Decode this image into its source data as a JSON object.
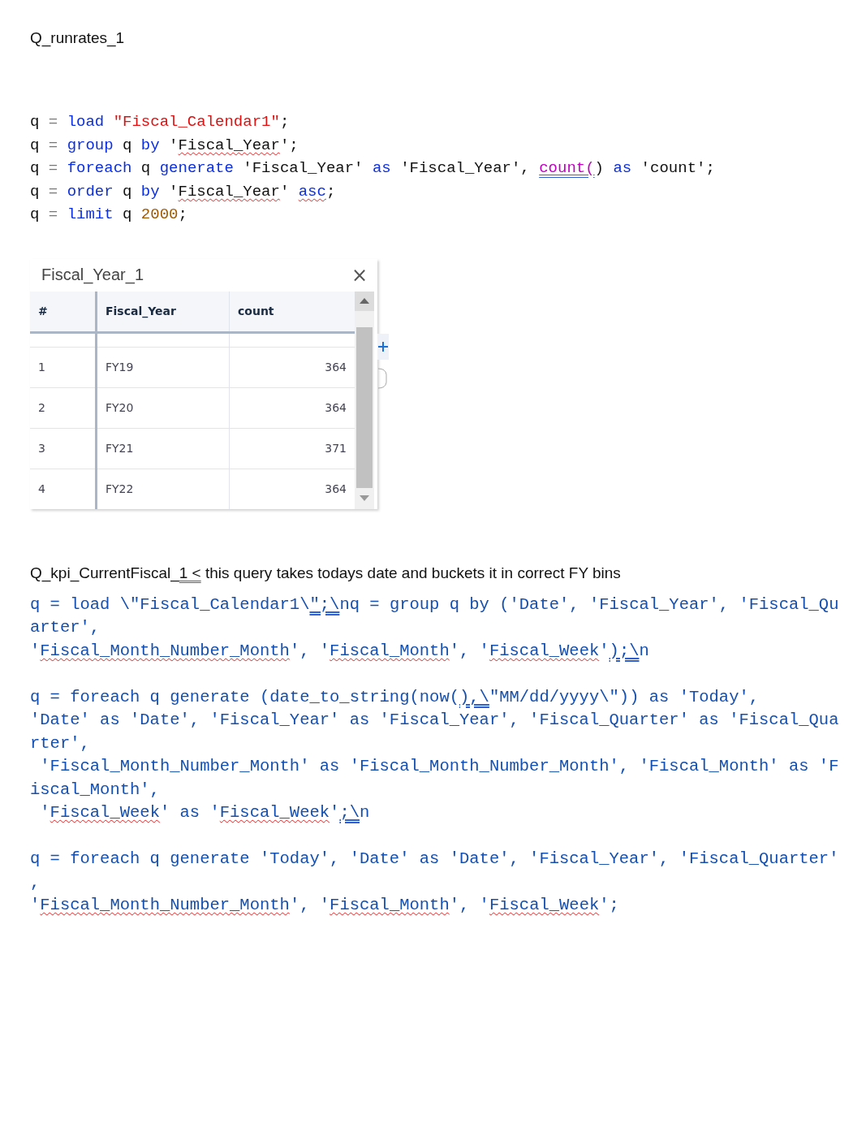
{
  "title": "Q_runrates_1",
  "query_lines": [
    [
      {
        "text": "q ",
        "kind": "plain",
        "spelling": false,
        "grammar": false
      },
      {
        "text": "= ",
        "kind": "op",
        "spelling": false,
        "grammar": false
      },
      {
        "text": "load",
        "kind": "kw",
        "spelling": false,
        "grammar": false
      },
      {
        "text": " \"Fiscal_Calendar1\"",
        "kind": "str",
        "spelling": false,
        "grammar": false
      },
      {
        "text": ";",
        "kind": "plain",
        "spelling": false,
        "grammar": false
      }
    ],
    [
      {
        "text": "q ",
        "kind": "plain",
        "spelling": false,
        "grammar": false
      },
      {
        "text": "= ",
        "kind": "op",
        "spelling": false,
        "grammar": false
      },
      {
        "text": "group",
        "kind": "kw",
        "spelling": false,
        "grammar": false
      },
      {
        "text": " q ",
        "kind": "plain",
        "spelling": false,
        "grammar": false
      },
      {
        "text": "by",
        "kind": "kw",
        "spelling": false,
        "grammar": false
      },
      {
        "text": " '",
        "kind": "plain",
        "spelling": false,
        "grammar": false
      },
      {
        "text": "Fiscal_Year",
        "kind": "plain",
        "spelling": true,
        "grammar": false
      },
      {
        "text": "';",
        "kind": "plain",
        "spelling": false,
        "grammar": false
      }
    ],
    [
      {
        "text": "q ",
        "kind": "plain",
        "spelling": false,
        "grammar": false
      },
      {
        "text": "= ",
        "kind": "op",
        "spelling": false,
        "grammar": false
      },
      {
        "text": "foreach",
        "kind": "kw",
        "spelling": false,
        "grammar": false
      },
      {
        "text": " q ",
        "kind": "plain",
        "spelling": false,
        "grammar": false
      },
      {
        "text": "generate",
        "kind": "kw",
        "spelling": false,
        "grammar": false
      },
      {
        "text": " 'Fiscal_Year' ",
        "kind": "plain",
        "spelling": false,
        "grammar": false
      },
      {
        "text": "as",
        "kind": "kw",
        "spelling": false,
        "grammar": false
      },
      {
        "text": " 'Fiscal_Year', ",
        "kind": "plain",
        "spelling": false,
        "grammar": false
      },
      {
        "text": "count(",
        "kind": "fn",
        "spelling": false,
        "grammar": true
      },
      {
        "text": ") ",
        "kind": "plain",
        "spelling": false,
        "grammar": false
      },
      {
        "text": "as",
        "kind": "kw",
        "spelling": false,
        "grammar": false
      },
      {
        "text": " 'count';",
        "kind": "plain",
        "spelling": false,
        "grammar": false
      }
    ],
    [
      {
        "text": "q ",
        "kind": "plain",
        "spelling": false,
        "grammar": false
      },
      {
        "text": "= ",
        "kind": "op",
        "spelling": false,
        "grammar": false
      },
      {
        "text": "order",
        "kind": "kw",
        "spelling": false,
        "grammar": false
      },
      {
        "text": " q ",
        "kind": "plain",
        "spelling": false,
        "grammar": false
      },
      {
        "text": "by",
        "kind": "kw",
        "spelling": false,
        "grammar": false
      },
      {
        "text": " '",
        "kind": "plain",
        "spelling": false,
        "grammar": false
      },
      {
        "text": "Fiscal_Year",
        "kind": "plain",
        "spelling": true,
        "grammar": false
      },
      {
        "text": "' ",
        "kind": "plain",
        "spelling": false,
        "grammar": false
      },
      {
        "text": "asc",
        "kind": "kw",
        "spelling": true,
        "grammar": false
      },
      {
        "text": ";",
        "kind": "plain",
        "spelling": false,
        "grammar": false
      }
    ],
    [
      {
        "text": "q ",
        "kind": "plain",
        "spelling": false,
        "grammar": false
      },
      {
        "text": "= ",
        "kind": "op",
        "spelling": false,
        "grammar": false
      },
      {
        "text": "limit",
        "kind": "kw",
        "spelling": false,
        "grammar": false
      },
      {
        "text": " q ",
        "kind": "plain",
        "spelling": false,
        "grammar": false
      },
      {
        "text": "2000",
        "kind": "num",
        "spelling": false,
        "grammar": false
      },
      {
        "text": ";",
        "kind": "plain",
        "spelling": false,
        "grammar": false
      }
    ]
  ],
  "result_panel": {
    "title": "Fiscal_Year_1",
    "close": "×",
    "columns": [
      "#",
      "Fiscal_Year",
      "count"
    ],
    "rows": [
      [
        "1",
        "FY19",
        "364"
      ],
      [
        "2",
        "FY20",
        "364"
      ],
      [
        "3",
        "FY21",
        "371"
      ],
      [
        "4",
        "FY22",
        "364"
      ]
    ]
  },
  "heading_2": [
    {
      "text": "Q_kpi_CurrentFiscal_",
      "grammar": false
    },
    {
      "text": "1 <",
      "grammar": true
    },
    {
      "text": " this query takes todays date and buckets it in correct FY bins",
      "grammar": false
    }
  ],
  "paragraphs": [
    [
      [
        {
          "text": "q = load \\\"Fiscal_Calendar1\\",
          "spelling": false,
          "grammar": false
        },
        {
          "text": "\";\\",
          "spelling": false,
          "grammar": true
        },
        {
          "text": "nq = group q by ('Date', 'Fiscal_Year', 'Fiscal_Qu",
          "spelling": false,
          "grammar": false
        }
      ],
      [
        {
          "text": "arter',",
          "spelling": false,
          "grammar": false
        }
      ],
      [
        {
          "text": "'",
          "spelling": false,
          "grammar": false
        },
        {
          "text": "Fiscal_Month_Number_Month",
          "spelling": true,
          "grammar": false
        },
        {
          "text": "', '",
          "spelling": false,
          "grammar": false
        },
        {
          "text": "Fiscal_Month",
          "spelling": true,
          "grammar": false
        },
        {
          "text": "', '",
          "spelling": false,
          "grammar": false
        },
        {
          "text": "Fiscal_Week",
          "spelling": true,
          "grammar": false
        },
        {
          "text": "'",
          "spelling": false,
          "grammar": false
        },
        {
          "text": ");\\",
          "spelling": false,
          "grammar": true
        },
        {
          "text": "n",
          "spelling": false,
          "grammar": false
        }
      ]
    ],
    [
      [
        {
          "text": "q = foreach q generate (date_to_string(now(",
          "spelling": false,
          "grammar": false
        },
        {
          "text": "),\\",
          "spelling": false,
          "grammar": true
        },
        {
          "text": "\"MM/dd/yyyy\\\")) as 'Today',",
          "spelling": false,
          "grammar": false
        }
      ],
      [
        {
          "text": "'Date' as 'Date', 'Fiscal_Year' as 'Fiscal_Year', 'Fiscal_Quarter' as 'Fiscal_Qua",
          "spelling": false,
          "grammar": false
        }
      ],
      [
        {
          "text": "rter',",
          "spelling": false,
          "grammar": false
        }
      ],
      [
        {
          "text": " 'Fiscal_Month_Number_Month' as 'Fiscal_Month_Number_Month', 'Fiscal_Month' as 'F",
          "spelling": false,
          "grammar": false
        }
      ],
      [
        {
          "text": "iscal_Month',",
          "spelling": false,
          "grammar": false
        }
      ],
      [
        {
          "text": " '",
          "spelling": false,
          "grammar": false
        },
        {
          "text": "Fiscal_Week",
          "spelling": true,
          "grammar": false
        },
        {
          "text": "' as '",
          "spelling": false,
          "grammar": false
        },
        {
          "text": "Fiscal_Week",
          "spelling": true,
          "grammar": false
        },
        {
          "text": "'",
          "spelling": false,
          "grammar": false
        },
        {
          "text": ";\\",
          "spelling": false,
          "grammar": true
        },
        {
          "text": "n",
          "spelling": false,
          "grammar": false
        }
      ]
    ],
    [
      [
        {
          "text": "q = foreach q generate 'Today', 'Date' as 'Date', 'Fiscal_Year', 'Fiscal_Quarter'",
          "spelling": false,
          "grammar": false
        }
      ],
      [
        {
          "text": ",",
          "spelling": false,
          "grammar": false
        }
      ],
      [
        {
          "text": "'",
          "spelling": false,
          "grammar": false
        },
        {
          "text": "Fiscal_Month_Number_Month",
          "spelling": true,
          "grammar": false
        },
        {
          "text": "', '",
          "spelling": false,
          "grammar": false
        },
        {
          "text": "Fiscal_Month",
          "spelling": true,
          "grammar": false
        },
        {
          "text": "', '",
          "spelling": false,
          "grammar": false
        },
        {
          "text": "Fiscal_Week",
          "spelling": true,
          "grammar": false
        },
        {
          "text": "';",
          "spelling": false,
          "grammar": false
        }
      ]
    ]
  ]
}
